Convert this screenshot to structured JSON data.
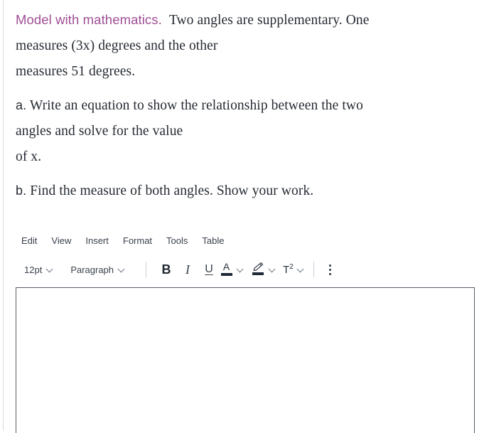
{
  "question": {
    "skill_label": "Model with mathematics.",
    "skill_color": "#9e4e95",
    "stem_line1": "Two angles are supplementary. One",
    "stem_line2": "measures (3x) degrees and the other",
    "stem_line3": "measures 51 degrees.",
    "part_a_label": "a.",
    "part_a_line1": "Write an equation to show the relationship between the two",
    "part_a_line2": "angles and solve for the value",
    "part_a_line3": "of x.",
    "part_b_label": "b.",
    "part_b_text": "Find the measure of both angles. Show your work."
  },
  "editor": {
    "menubar": [
      {
        "label": "Edit"
      },
      {
        "label": "View"
      },
      {
        "label": "Insert"
      },
      {
        "label": "Format"
      },
      {
        "label": "Tools"
      },
      {
        "label": "Table"
      }
    ],
    "toolbar": {
      "font_size_value": "12pt",
      "block_format_value": "Paragraph",
      "bold_label": "B",
      "italic_label": "I",
      "underline_label": "U",
      "text_color_glyph": "A",
      "text_color_swatch": "#1f2937",
      "highlight_swatch": "#1f2937",
      "superscript_base": "T",
      "superscript_exponent": "2",
      "more_options_label": ""
    },
    "compose_value": "",
    "compose_placeholder": ""
  }
}
